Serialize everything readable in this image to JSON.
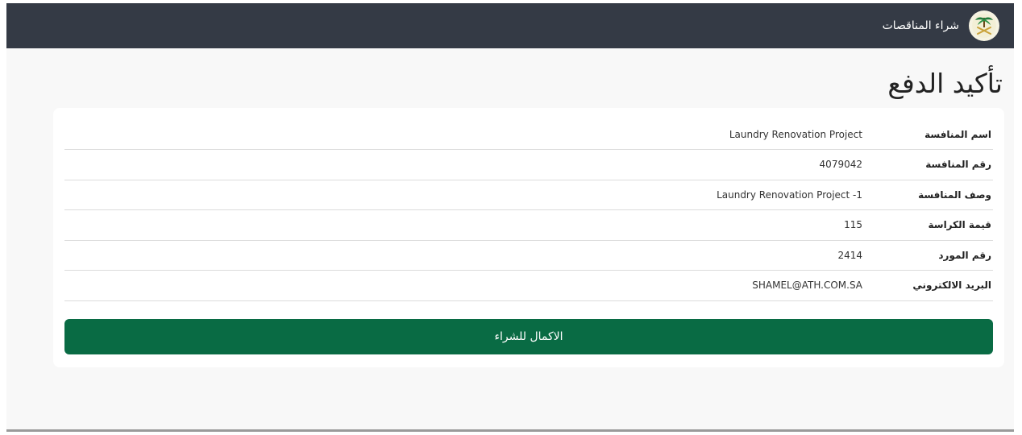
{
  "navbar": {
    "brand_title": "شراء المناقصات",
    "logo_icon": "palm-swords-emblem-icon"
  },
  "page": {
    "title": "تأكيد الدفع"
  },
  "details": {
    "rows": [
      {
        "label": "اسم المنافسة",
        "value": "Laundry Renovation Project"
      },
      {
        "label": "رقم المنافسة",
        "value": "4079042"
      },
      {
        "label": "وصف المنافسة",
        "value": "Laundry Renovation Project -1"
      },
      {
        "label": "قيمة الكراسة",
        "value": "115"
      },
      {
        "label": "رقم المورد",
        "value": "2414"
      },
      {
        "label": "البريد الالكتروني",
        "value": "SHAMEL@ATH.COM.SA"
      }
    ]
  },
  "actions": {
    "complete_purchase_label": "الاكمال للشراء"
  },
  "colors": {
    "navbar_bg": "#343a45",
    "primary_button": "#096b44",
    "page_bg": "#f8f8f8"
  }
}
